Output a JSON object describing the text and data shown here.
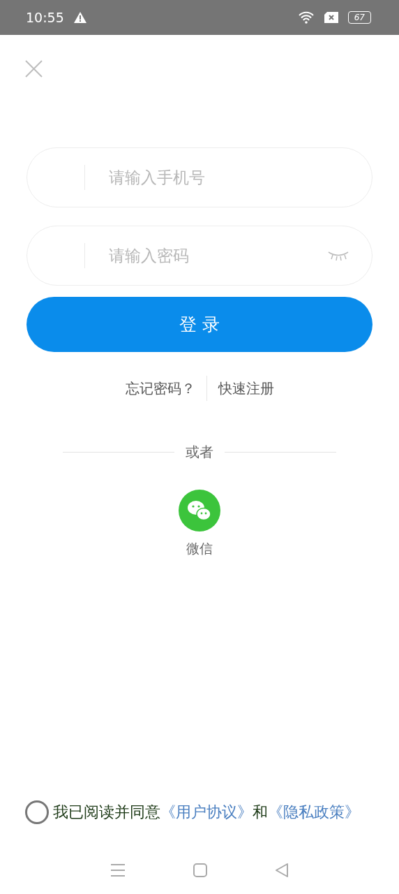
{
  "status_bar": {
    "time": "10:55",
    "battery": "67"
  },
  "fields": [
    {
      "placeholder": "请输入手机号",
      "kind": "phone"
    },
    {
      "placeholder": "请输入密码",
      "kind": "password"
    }
  ],
  "login_button": "登 录",
  "links": [
    "忘记密码？",
    "快速注册"
  ],
  "divider": "或者",
  "social": [
    {
      "label": "微信"
    }
  ],
  "agreement": {
    "checked": false,
    "text": "我已阅读并同意",
    "links": [
      "《用户协议》",
      "《隐私政策》"
    ],
    "joiner": "和"
  }
}
